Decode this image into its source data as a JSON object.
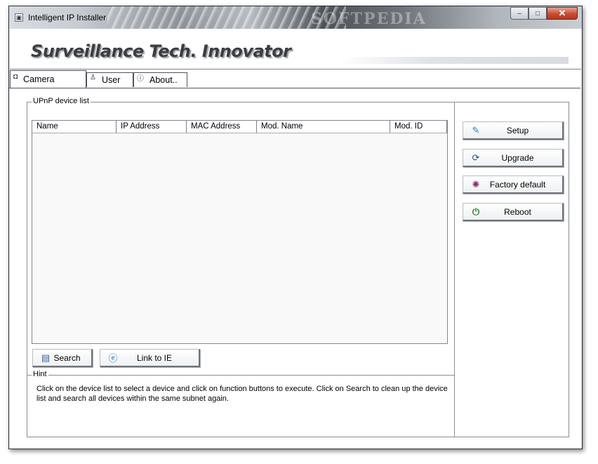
{
  "window": {
    "title": "Intelligent IP Installer",
    "watermark": "SOFTPEDIA",
    "minimize_glyph": "–",
    "maximize_glyph": "□",
    "close_glyph": "✕"
  },
  "banner": {
    "title": "Surveillance Tech. Innovator"
  },
  "tabs": [
    {
      "label": "Camera",
      "icon": "camera-icon",
      "active": true
    },
    {
      "label": "User",
      "icon": "user-icon",
      "active": false
    },
    {
      "label": "About..",
      "icon": "info-icon",
      "active": false
    }
  ],
  "device_list": {
    "group_label": "UPnP device list",
    "columns": [
      "Name",
      "IP Address",
      "MAC Address",
      "Mod. Name",
      "Mod. ID"
    ],
    "rows": []
  },
  "list_buttons": {
    "search": "Search",
    "link_ie": "Link to IE"
  },
  "side_buttons": {
    "setup": "Setup",
    "upgrade": "Upgrade",
    "factory_default": "Factory default",
    "reboot": "Reboot"
  },
  "hint": {
    "label": "Hint",
    "text": "Click on the device list to select a device and click on function buttons to execute. Click on Search to clean up the device list and search all devices  within the same subnet again."
  },
  "colors": {
    "setup_icon": "#2f7fd1",
    "upgrade_icon": "#1f4f8f",
    "factory_icon": "#8b2a6a",
    "reboot_icon": "#2e7d32",
    "close_button": "#c74b33"
  }
}
